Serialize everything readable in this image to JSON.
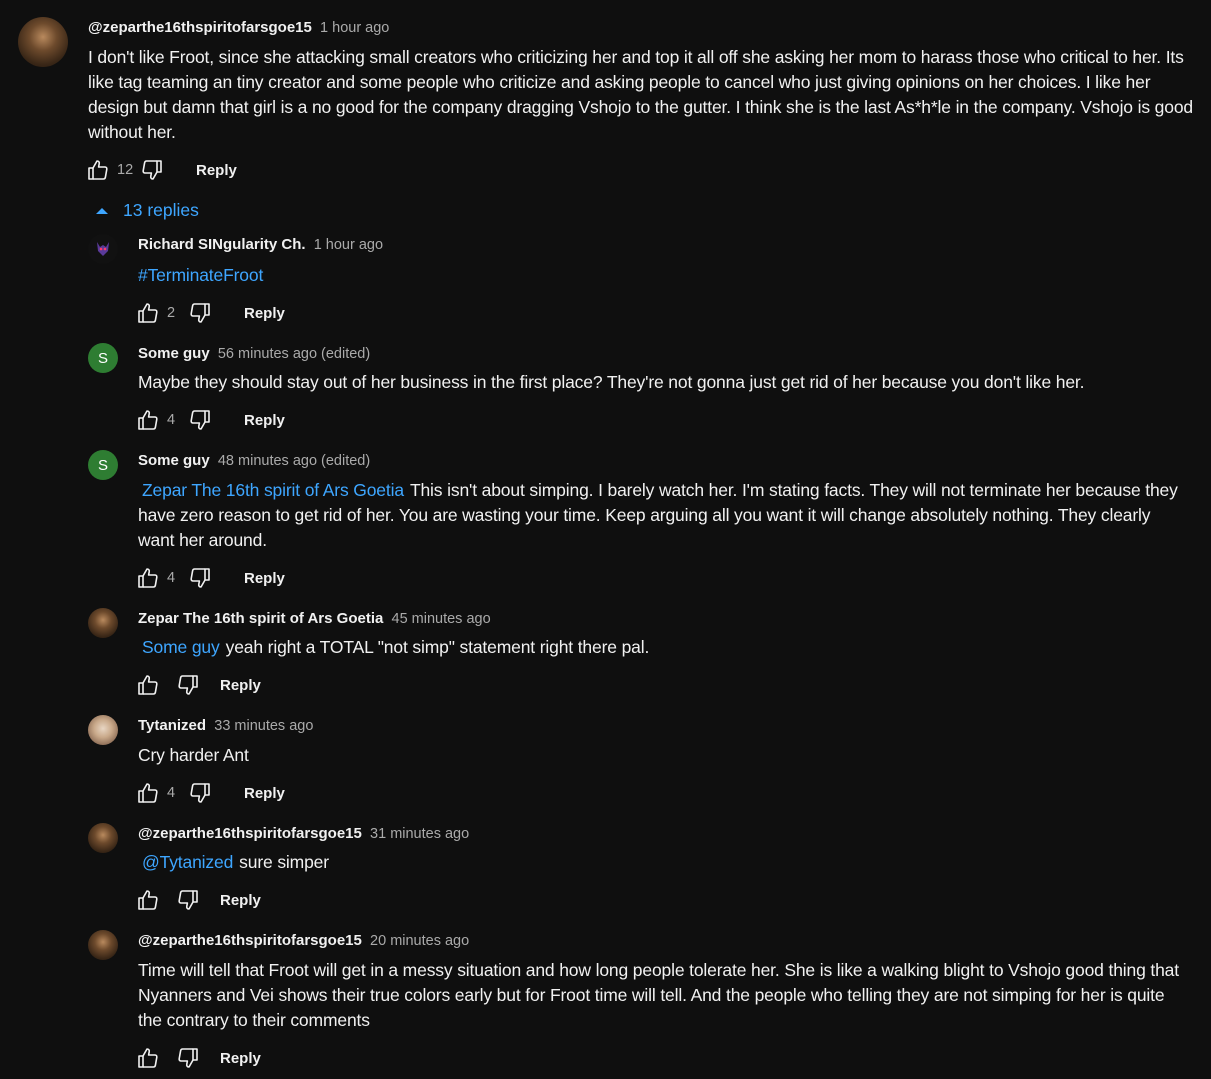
{
  "main_comment": {
    "author": "@zeparthe16thspiritofarsgoe15",
    "time": "1 hour ago",
    "text": "I don't like Froot, since she attacking small creators who criticizing her and top it all off she asking her mom to harass those who critical to her. Its like tag teaming an tiny creator and some people who criticize and asking people to cancel who just giving opinions on her choices. I like her design but damn that girl is a no good for the company dragging Vshojo to the gutter. I think she is the last As*h*le in the company. Vshojo is good without her.",
    "likes": "12",
    "reply_label": "Reply"
  },
  "replies_toggle": {
    "label": "13 replies"
  },
  "replies": [
    {
      "author": "Richard SINgularity Ch.",
      "time": "1 hour ago",
      "mention": "",
      "text": "#TerminateFroot",
      "likes": "2",
      "reply_label": "Reply",
      "avatar": "richard"
    },
    {
      "author": "Some guy",
      "time": "56 minutes ago (edited)",
      "mention": "",
      "text": "Maybe they should stay out of her business in the first place? They're not gonna just get rid of her because you don't like her.",
      "likes": "4",
      "reply_label": "Reply",
      "avatar": "S"
    },
    {
      "author": "Some guy",
      "time": "48 minutes ago (edited)",
      "mention": "Zepar The 16th spirit of Ars Goetia",
      "text": "This isn't about simping. I barely watch her. I'm stating facts. They will not terminate her because they have zero reason to get rid of her. You are wasting your time. Keep arguing all you want it will change absolutely nothing. They clearly want her around.",
      "likes": "4",
      "reply_label": "Reply",
      "avatar": "S"
    },
    {
      "author": "Zepar The 16th spirit of Ars Goetia",
      "time": "45 minutes ago",
      "mention": "Some guy",
      "text": "yeah right a TOTAL \"not simp\" statement right there pal.",
      "likes": "",
      "reply_label": "Reply",
      "avatar": "zepar"
    },
    {
      "author": "Tytanized",
      "time": "33 minutes ago",
      "mention": "",
      "text": "Cry harder Ant",
      "likes": "4",
      "reply_label": "Reply",
      "avatar": "tytanized"
    },
    {
      "author": "@zeparthe16thspiritofarsgoe15",
      "time": "31 minutes ago",
      "mention": "@Tytanized",
      "text": "sure simper",
      "likes": "",
      "reply_label": "Reply",
      "avatar": "zepar"
    },
    {
      "author": "@zeparthe16thspiritofarsgoe15",
      "time": "20 minutes ago",
      "mention": "",
      "text": "Time will tell that Froot will get in a messy situation and how long people tolerate her. She is like a walking blight to Vshojo good thing that Nyanners and Vei shows their true colors early but for Froot time will tell. And the people who telling they are not simping for her is quite the contrary to their comments",
      "likes": "",
      "reply_label": "Reply",
      "avatar": "zepar"
    }
  ],
  "icons": {
    "like": "thumbs-up-icon",
    "dislike": "thumbs-down-icon",
    "collapse": "chevron-up-icon"
  },
  "colors": {
    "background": "#0f0f0f",
    "link": "#3ea6ff",
    "secondary_text": "#aaaaaa",
    "avatar_green": "#2e7d32"
  }
}
